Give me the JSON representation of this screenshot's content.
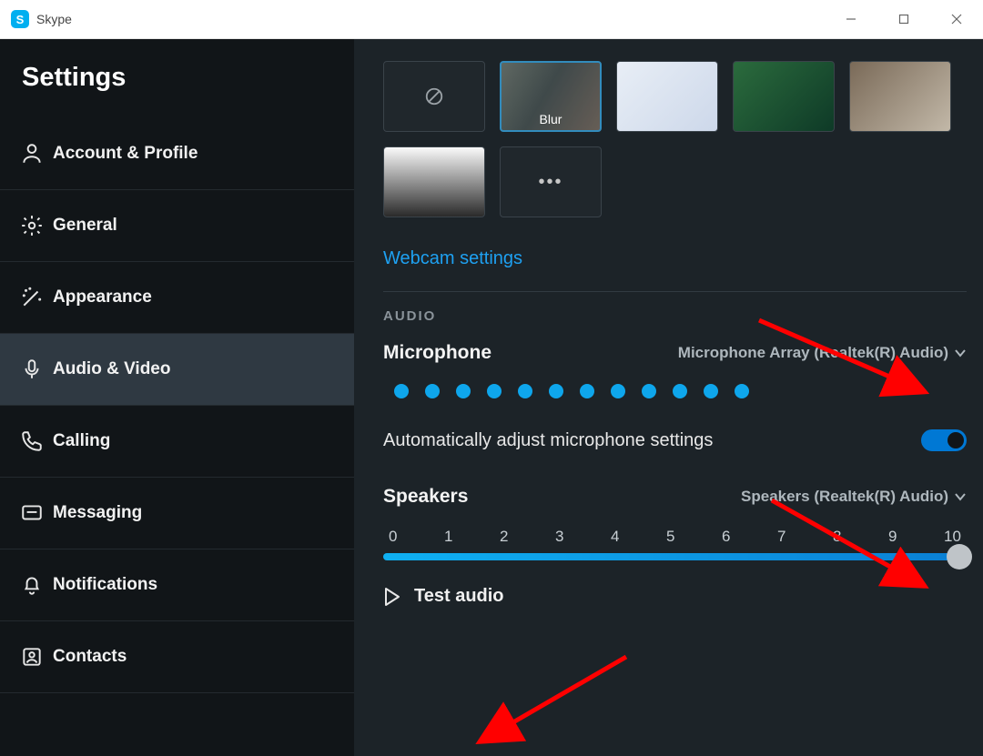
{
  "window": {
    "app_name": "Skype"
  },
  "sidebar": {
    "title": "Settings",
    "items": [
      {
        "icon": "person",
        "label": "Account & Profile"
      },
      {
        "icon": "gear",
        "label": "General"
      },
      {
        "icon": "wand",
        "label": "Appearance"
      },
      {
        "icon": "mic",
        "label": "Audio & Video"
      },
      {
        "icon": "phone",
        "label": "Calling"
      },
      {
        "icon": "message",
        "label": "Messaging"
      },
      {
        "icon": "bell",
        "label": "Notifications"
      },
      {
        "icon": "contacts",
        "label": "Contacts"
      }
    ],
    "active_index": 3
  },
  "backgrounds": {
    "tiles": [
      {
        "kind": "none",
        "label": ""
      },
      {
        "kind": "blur",
        "label": "Blur",
        "selected": true
      },
      {
        "kind": "image1"
      },
      {
        "kind": "image2"
      },
      {
        "kind": "image3"
      },
      {
        "kind": "image4"
      },
      {
        "kind": "more"
      }
    ]
  },
  "webcam_link": "Webcam settings",
  "audio": {
    "section_label": "AUDIO",
    "mic_label": "Microphone",
    "mic_device": "Microphone Array (Realtek(R) Audio)",
    "mic_level_dots": 12,
    "auto_adjust_label": "Automatically adjust microphone settings",
    "auto_adjust_on": true,
    "speakers_label": "Speakers",
    "speakers_device": "Speakers (Realtek(R) Audio)",
    "speaker_slider": {
      "min": 0,
      "max": 10,
      "value": 10,
      "ticks": [
        "0",
        "1",
        "2",
        "3",
        "4",
        "5",
        "6",
        "7",
        "8",
        "9",
        "10"
      ]
    },
    "test_audio_label": "Test audio"
  },
  "annotation_arrows": [
    {
      "from": [
        362,
        365
      ],
      "to": [
        232,
        463
      ]
    },
    {
      "from": [
        866,
        352
      ],
      "to": [
        1044,
        429
      ]
    },
    {
      "from": [
        880,
        550
      ],
      "to": [
        1044,
        642
      ]
    },
    {
      "from": [
        720,
        722
      ],
      "to": [
        563,
        813
      ]
    }
  ]
}
